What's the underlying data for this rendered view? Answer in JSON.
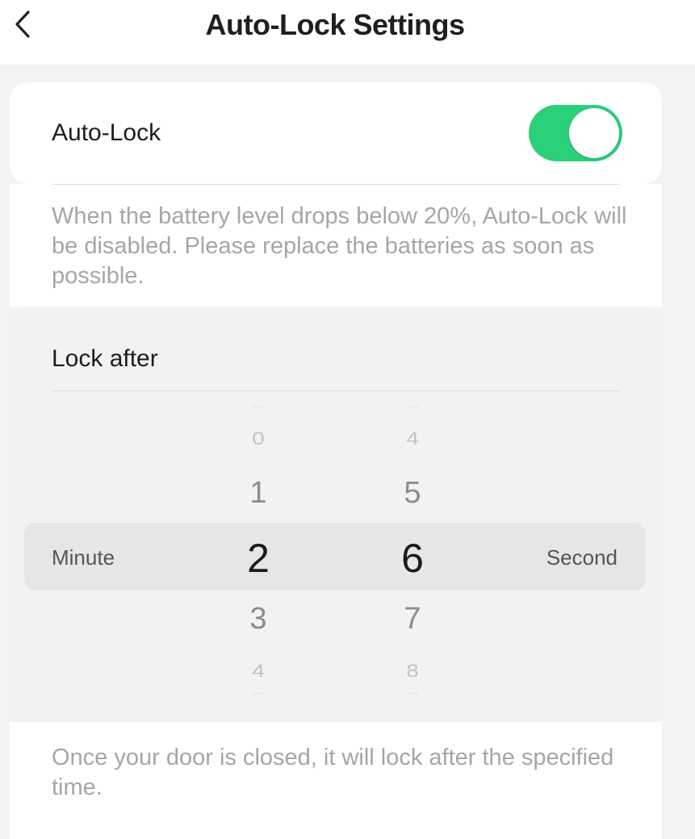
{
  "header": {
    "title": "Auto-Lock Settings",
    "back_icon": "chevron-left-icon"
  },
  "auto_lock": {
    "label": "Auto-Lock",
    "enabled": true,
    "toggle_color": "#2bd07a"
  },
  "battery_note": "When the battery level drops below 20%, Auto-Lock will be disabled. Please replace the batteries as soon as possible.",
  "lock_after": {
    "label": "Lock after",
    "minute_label": "Minute",
    "second_label": "Second",
    "minute_picker": {
      "items": [
        "0",
        "1",
        "2",
        "3",
        "4"
      ],
      "selected": "2"
    },
    "second_picker": {
      "items": [
        "4",
        "5",
        "6",
        "7",
        "8"
      ],
      "selected": "6"
    }
  },
  "lock_note": "Once your door is closed, it will lock after the specified time."
}
